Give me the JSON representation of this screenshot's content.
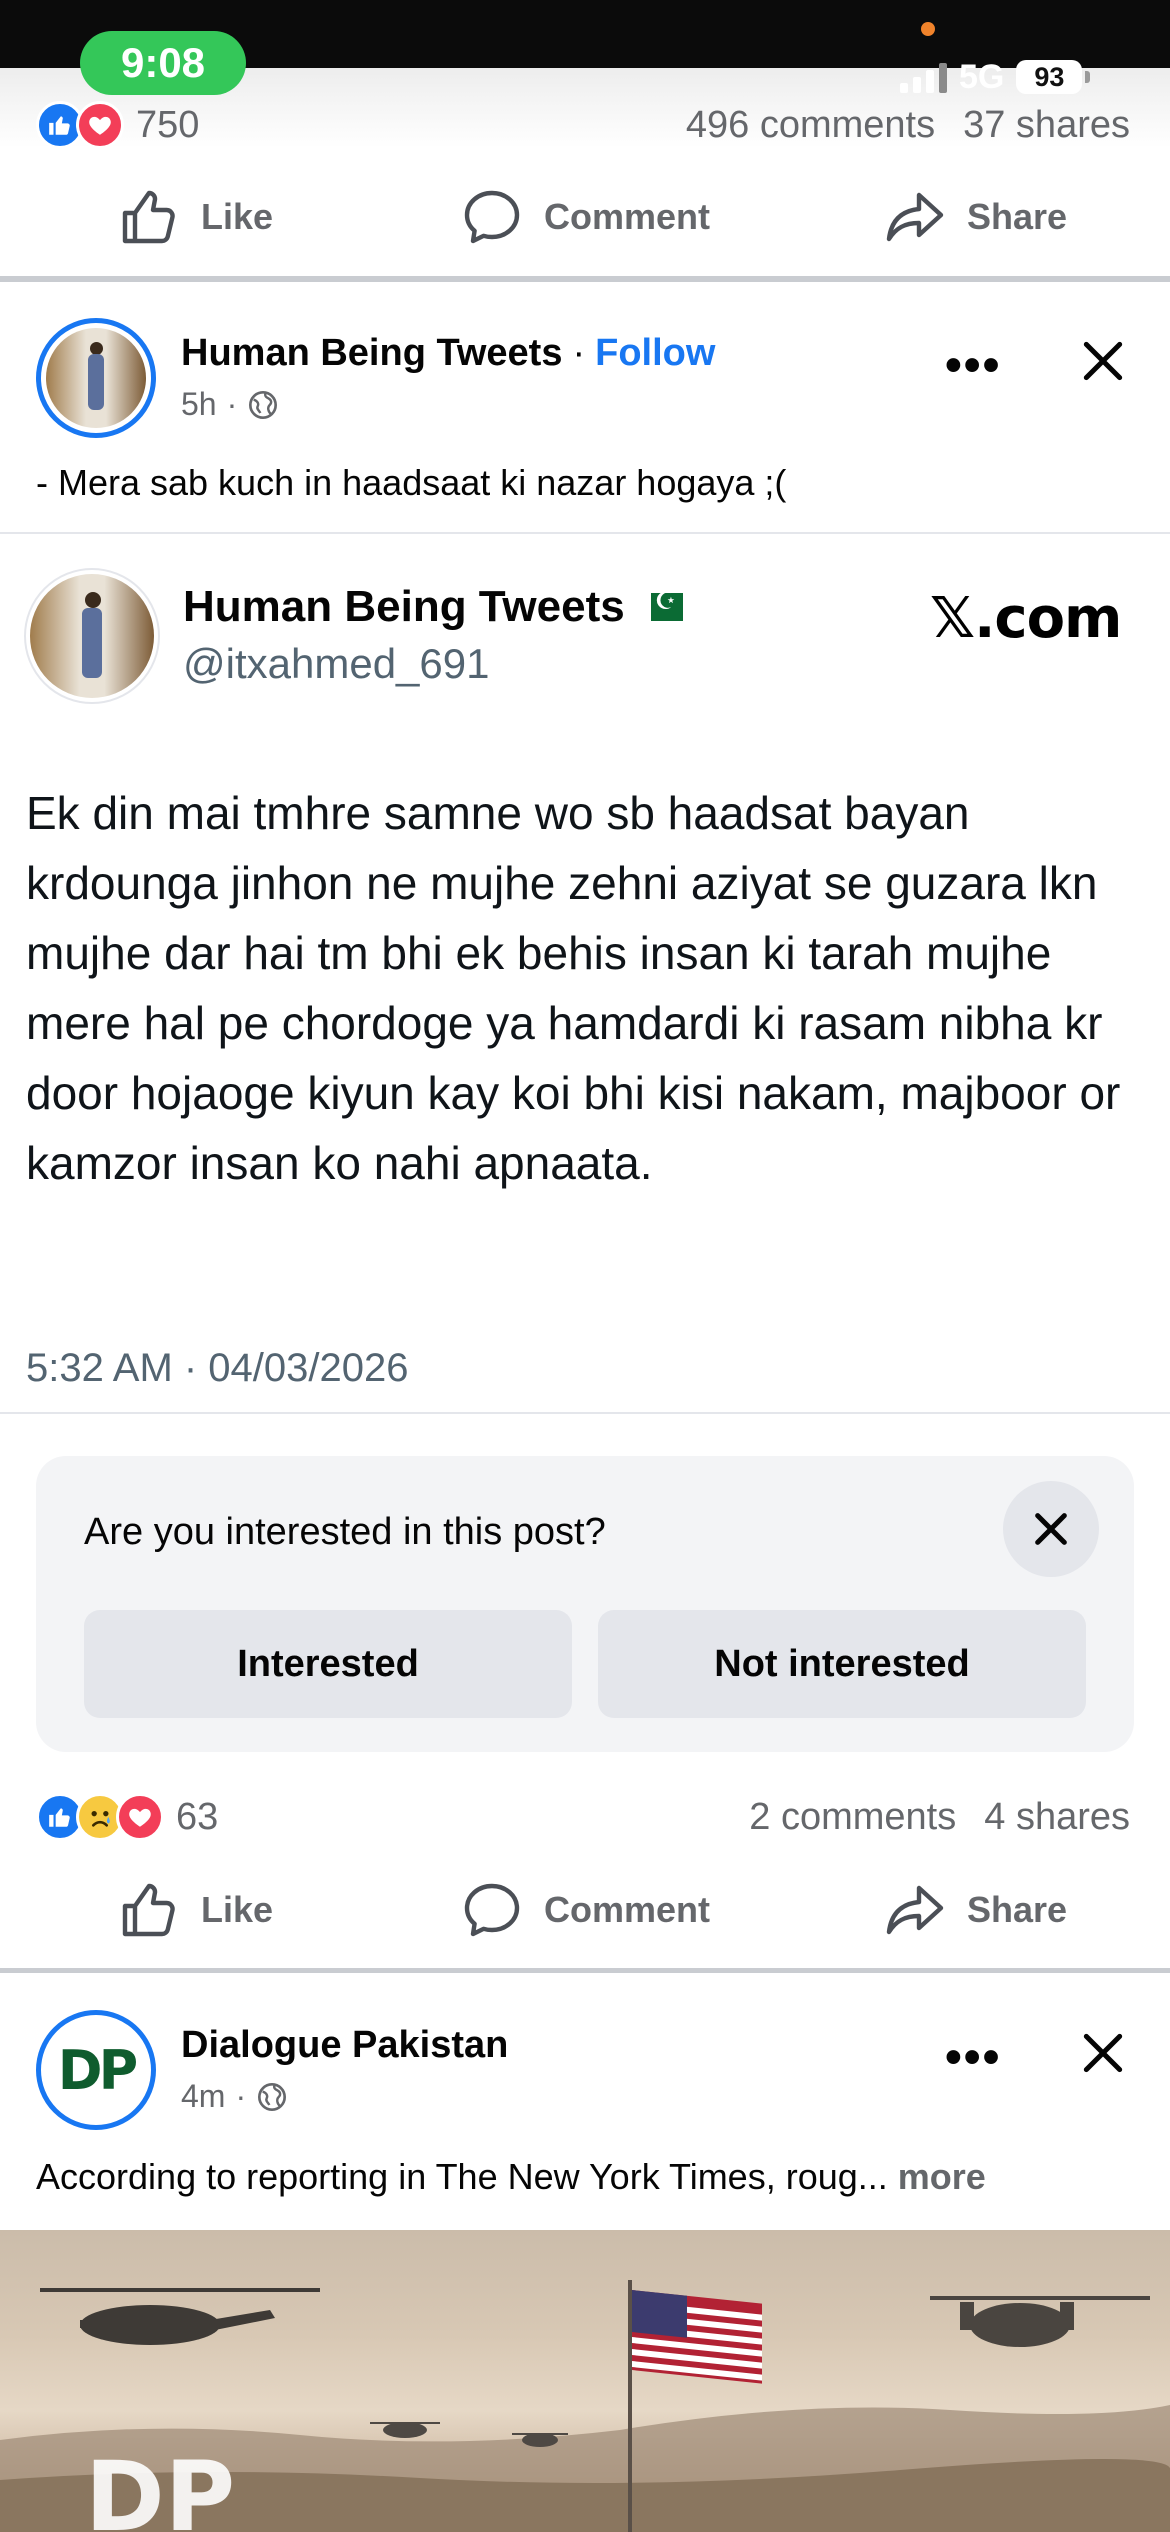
{
  "status_bar": {
    "time": "9:08",
    "network": "5G",
    "battery": "93"
  },
  "prev_post": {
    "reaction_count": "750",
    "comments": "496 comments",
    "shares": "37 shares"
  },
  "actions": {
    "like": "Like",
    "comment": "Comment",
    "share": "Share"
  },
  "post1": {
    "author": "Human Being Tweets",
    "separator": "·",
    "follow": "Follow",
    "time": "5h",
    "meta_separator": "·",
    "caption": "- Mera sab kuch in haadsaat ki nazar hogaya ;(",
    "tweet": {
      "name": "Human Being Tweets",
      "handle": "@itxahmed_691",
      "source": "𝕏.com",
      "text": "Ek din mai tmhre samne wo sb haadsat bayan krdounga jinhon ne mujhe zehni aziyat se guzara lkn mujhe dar hai tm bhi ek behis insan ki tarah mujhe mere hal pe chordoge ya hamdardi ki rasam nibha kr door hojaoge kiyun kay koi bhi kisi nakam, majboor or kamzor insan ko nahi apnaata.",
      "timestamp": "5:32 AM · 04/03/2026"
    },
    "interest": {
      "question": "Are you interested in this post?",
      "interested": "Interested",
      "not_interested": "Not interested"
    },
    "reaction_count": "63",
    "comments": "2 comments",
    "shares": "4 shares"
  },
  "post2": {
    "author": "Dialogue Pakistan",
    "logo_text": "DP",
    "time": "4m",
    "meta_separator": "·",
    "caption": "According to reporting in The New York Times, roug...",
    "more": "more"
  },
  "colors": {
    "accent": "#1877f2",
    "like": "#1877f2",
    "love": "#f33e58",
    "status_green": "#34c759"
  },
  "icons": [
    "like-icon",
    "comment-icon",
    "share-icon",
    "globe-icon",
    "close-icon",
    "more-dots-icon"
  ]
}
